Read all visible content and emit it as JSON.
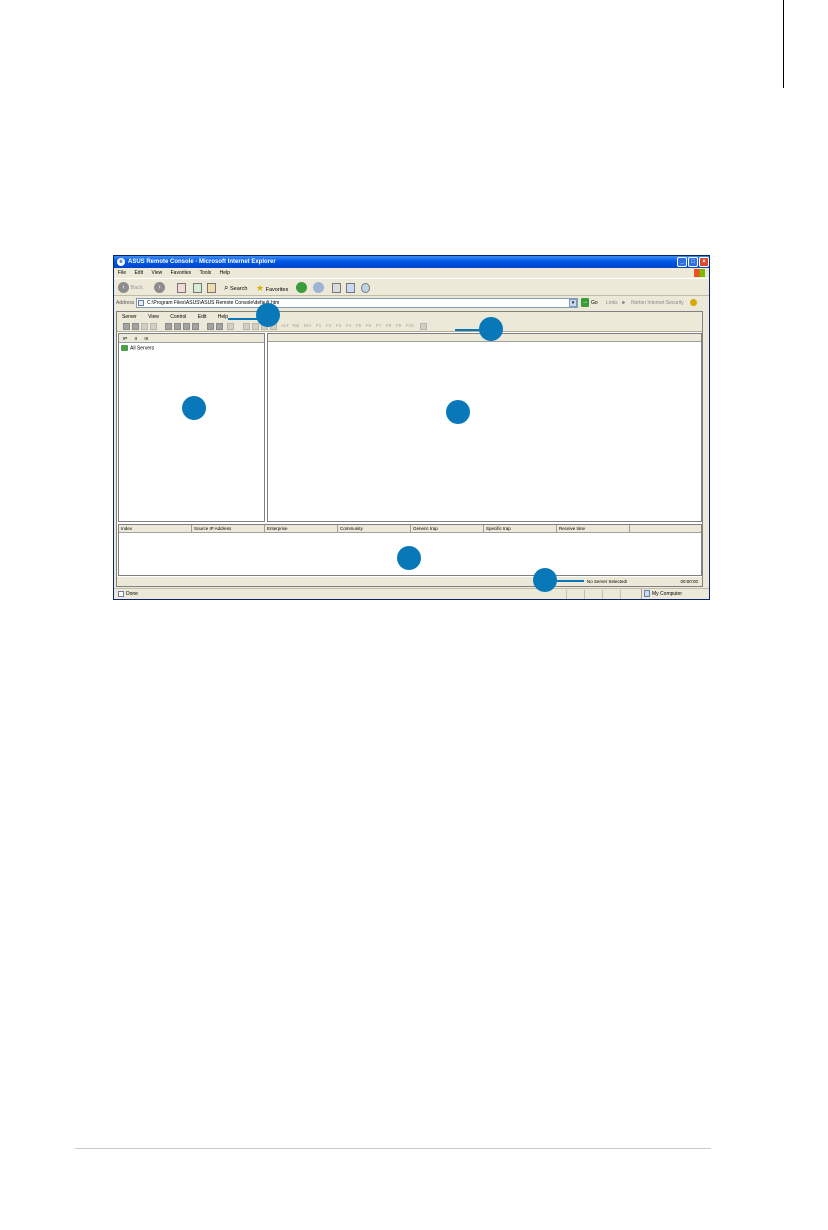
{
  "window": {
    "title": "ASUS Remote Console - Microsoft Internet Explorer",
    "controls": [
      "_",
      "□",
      "×"
    ]
  },
  "ie_menu": [
    "File",
    "Edit",
    "View",
    "Favorites",
    "Tools",
    "Help"
  ],
  "ie_toolbar": {
    "back": "Back",
    "search": "Search",
    "favorites": "Favorites"
  },
  "address": {
    "label": "Address",
    "value": "C:\\Program Files\\ASUS\\ASUS Remote Console\\default.htm",
    "go": "Go",
    "links": "Links",
    "chevron": "»",
    "norton": "Norton Internet Security"
  },
  "app": {
    "menu": [
      "Server",
      "View",
      "Control",
      "Edit",
      "Help"
    ],
    "fkeys": [
      "ALT",
      "Tab",
      "Del",
      "F1",
      "F2",
      "F3",
      "F4",
      "F5",
      "F6",
      "F7",
      "F8",
      "F9",
      "F10"
    ],
    "left_tabs": [
      "IP",
      "II",
      "III"
    ],
    "tree_root": "All Servers",
    "trap_columns": [
      "Index",
      "Source IP Address",
      "Enterprise",
      "Community",
      "Generic trap",
      "Specific trap",
      "Receive time"
    ],
    "status_message": "No Server Selected!",
    "status_time": "00:00:00"
  },
  "ie_status": {
    "left": "Done",
    "zone": "My Computer"
  },
  "colors": {
    "callout": "#0878b8",
    "xp_title": "#0058e6",
    "chrome": "#ece9d8"
  }
}
